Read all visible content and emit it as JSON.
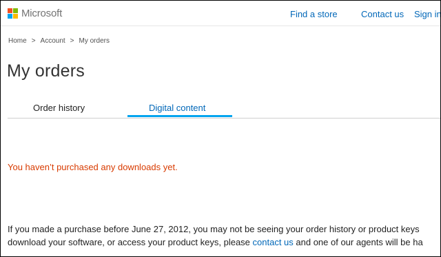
{
  "header": {
    "logo_text": "Microsoft",
    "logo_colors": [
      "#f25022",
      "#7fba00",
      "#00a4ef",
      "#ffb900"
    ],
    "nav": [
      {
        "label": "Find a store"
      },
      {
        "label": "Contact us"
      },
      {
        "label": "Sign in"
      }
    ]
  },
  "breadcrumb": {
    "items": [
      "Home",
      "Account",
      "My orders"
    ],
    "separator": ">"
  },
  "page_title": "My orders",
  "tabs": [
    {
      "label": "Order history",
      "active": false
    },
    {
      "label": "Digital content",
      "active": true
    }
  ],
  "empty_message": "You haven’t purchased any downloads yet.",
  "footnote": {
    "line1": "If you made a purchase before June 27, 2012, you may not be seeing your order history or product keys",
    "line2_before": "download your software, or access your product keys, please ",
    "line2_link": "contact us",
    "line2_after": " and one of our agents will be ha"
  },
  "colors": {
    "link": "#0067b8",
    "accent_underline": "#00a4ef",
    "warning_text": "#d83b01"
  }
}
